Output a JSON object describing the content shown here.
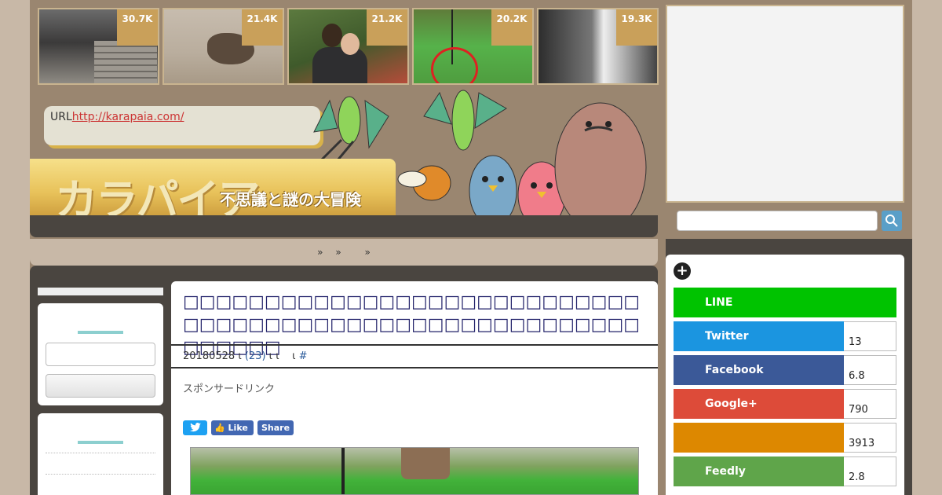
{
  "thumbnails": [
    {
      "count": "30.7K"
    },
    {
      "count": "21.4K"
    },
    {
      "count": "21.2K"
    },
    {
      "count": "20.2K"
    },
    {
      "count": "19.3K"
    }
  ],
  "header": {
    "url_label": "URL",
    "url_link": "http://karapaia.com/",
    "logo_text": "カラパイア",
    "logo_subtitle": "不思議と謎の大冒険"
  },
  "nav": {
    "items": [
      "»",
      "»",
      "»"
    ]
  },
  "article": {
    "title": "□□□□□□□□□□□□□□□□□□□□□□□□□□□□□□□□□□□□□□□□□□□□□□□□□□□□□□□□□□□□□□",
    "date": "20180528",
    "comments": "(23)",
    "hash": "#",
    "sponsor_text": "スポンサードリンク",
    "tweet_label": "🐦",
    "like_label": "Like",
    "share_label": "Share"
  },
  "share_buttons": [
    {
      "label": "LINE",
      "count": "",
      "color": "#00c300"
    },
    {
      "label": "Twitter",
      "count": "13",
      "color": "#1b95e0"
    },
    {
      "label": "Facebook",
      "count": "6.8",
      "color": "#3b5998"
    },
    {
      "label": "Google+",
      "count": "790",
      "color": "#dd4b39"
    },
    {
      "label": "",
      "count": "3913",
      "color": "#dd8800"
    },
    {
      "label": "Feedly",
      "count": "2.8",
      "color": "#5fa54a"
    }
  ],
  "search": {
    "placeholder": "",
    "button_icon": "search-icon"
  },
  "icons": {
    "plus": "plus-icon"
  }
}
